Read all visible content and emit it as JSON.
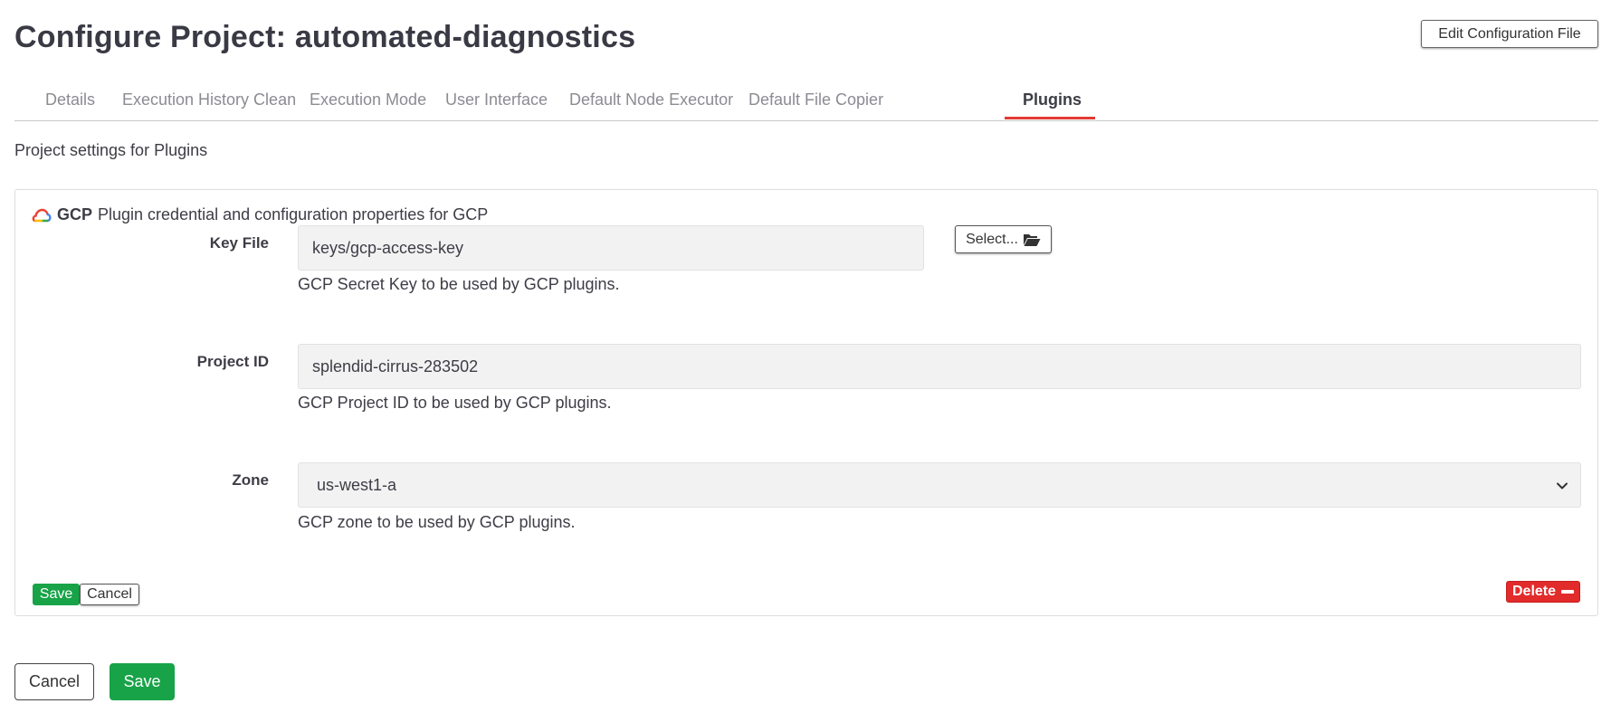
{
  "page": {
    "title": "Configure Project: automated-diagnostics",
    "edit_config_label": "Edit Configuration File",
    "section_description": "Project settings for Plugins"
  },
  "tabs": [
    {
      "label": "Details",
      "active": false
    },
    {
      "label": "Execution History Clean",
      "active": false
    },
    {
      "label": "Execution Mode",
      "active": false
    },
    {
      "label": "User Interface",
      "active": false
    },
    {
      "label": "Default Node Executor",
      "active": false
    },
    {
      "label": "Default File Copier",
      "active": false
    },
    {
      "label": "Plugins",
      "active": true
    }
  ],
  "plugin": {
    "icon": "gcp-cloud-icon",
    "name": "GCP",
    "description": "Plugin credential and configuration properties for GCP",
    "fields": {
      "key_file": {
        "label": "Key File",
        "value": "keys/gcp-access-key",
        "help": "GCP Secret Key to be used by GCP plugins.",
        "select_label": "Select...",
        "select_icon": "folder-open-icon"
      },
      "project_id": {
        "label": "Project ID",
        "value": "splendid-cirrus-283502",
        "help": "GCP Project ID to be used by GCP plugins."
      },
      "zone": {
        "label": "Zone",
        "value": "us-west1-a",
        "help": "GCP zone to be used by GCP plugins."
      }
    },
    "save_label": "Save",
    "cancel_label": "Cancel",
    "delete_label": "Delete"
  },
  "footer": {
    "cancel_label": "Cancel",
    "save_label": "Save"
  },
  "colors": {
    "accent_red": "#e03b35",
    "save_green": "#18a348",
    "delete_red": "#e22b2b"
  }
}
